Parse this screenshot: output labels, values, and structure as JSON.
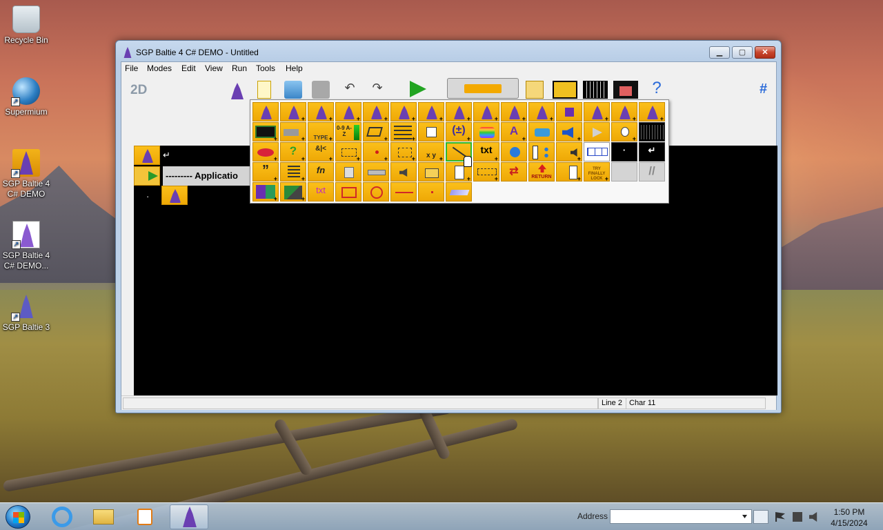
{
  "desktop": {
    "icons": [
      {
        "label": "Recycle Bin"
      },
      {
        "label": "Supermium"
      },
      {
        "label": "SGP Baltie 4 C# DEMO"
      },
      {
        "label": "SGP Baltie 4 C# DEMO..."
      },
      {
        "label": "SGP Baltie 3"
      }
    ]
  },
  "window": {
    "title": "SGP Baltie 4 C# DEMO - Untitled",
    "controls": {
      "minimize": "▁",
      "maximize": "▢",
      "close": "✕"
    },
    "menu": [
      "File",
      "Modes",
      "Edit",
      "View",
      "Run",
      "Tools",
      "Help"
    ],
    "toolbar": {
      "mode_label": "2D",
      "hash_label": "#",
      "help_label": "?",
      "undo_label": "↶",
      "redo_label": "↷"
    },
    "editor": {
      "application_line": "--------- Applicatio",
      "return_glyph": "↵",
      "dot_glyph": "·"
    },
    "status": {
      "line": "Line 2",
      "char": "Char 11"
    }
  },
  "palette": {
    "texts": {
      "fn": "fn",
      "txt": "txt",
      "txt2": "txt",
      "try": "TRY FINALLY LOCK",
      "return": "RETURN",
      "az": "0-9 A-Z",
      "type": "TYPE",
      "xy": "x y",
      "quote": "”",
      "slash": "//",
      "ret": "↵",
      "dot": "·"
    }
  },
  "taskbar": {
    "address_label": "Address",
    "address_value": "",
    "time": "1:50 PM",
    "date": "4/15/2024"
  }
}
